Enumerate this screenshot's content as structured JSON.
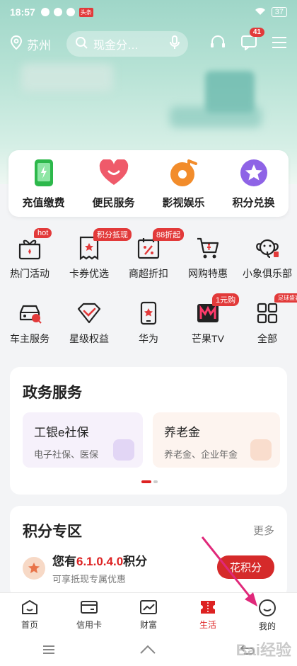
{
  "status": {
    "time": "18:57",
    "battery": "37",
    "app_badge": "头条"
  },
  "topbar": {
    "location": "苏州",
    "search_placeholder": "现金分…",
    "msg_count": "41"
  },
  "quick": [
    {
      "label": "充值缴费"
    },
    {
      "label": "便民服务"
    },
    {
      "label": "影视娱乐"
    },
    {
      "label": "积分兑换"
    }
  ],
  "grid": [
    {
      "label": "热门活动",
      "tag": "hot"
    },
    {
      "label": "卡券优选",
      "tag": "积分抵现"
    },
    {
      "label": "商超折扣",
      "tag": "88折起"
    },
    {
      "label": "网购特惠",
      "tag": ""
    },
    {
      "label": "小象俱乐部",
      "tag": ""
    },
    {
      "label": "车主服务",
      "tag": ""
    },
    {
      "label": "星级权益",
      "tag": ""
    },
    {
      "label": "华为",
      "tag": ""
    },
    {
      "label": "芒果TV",
      "tag": "1元购"
    },
    {
      "label": "全部",
      "tag": "足球盛宴"
    }
  ],
  "gov": {
    "title": "政务服务",
    "cards": [
      {
        "title": "工银e社保",
        "sub": "电子社保、医保"
      },
      {
        "title": "养老金",
        "sub": "养老金、企业年金"
      }
    ]
  },
  "points": {
    "title": "积分专区",
    "more": "更多",
    "prefix": "您有",
    "value": "6.1.0.4.0",
    "suffix": "积分",
    "sub": "可享抵现专属优惠",
    "button": "花积分"
  },
  "tabs": [
    {
      "label": "首页"
    },
    {
      "label": "信用卡"
    },
    {
      "label": "财富"
    },
    {
      "label": "生活"
    },
    {
      "label": "我的"
    }
  ],
  "watermark": "Bai经验",
  "colors": {
    "brand_red": "#d22",
    "accent_green": "#2db84b"
  }
}
